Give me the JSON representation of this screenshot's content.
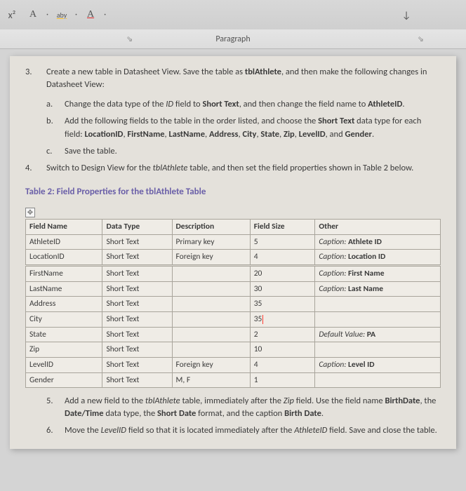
{
  "ribbon": {
    "superscript": "x²",
    "font_a1": "A",
    "highlighter": "aby",
    "font_a2": "A",
    "paragraph_label": "Paragraph",
    "launcher": "⇘"
  },
  "step3": {
    "num": "3.",
    "text_before_bold": "Create a new table in Datasheet View. Save the table as ",
    "bold1": "tblAthlete",
    "text_after_bold": ", and then make the following changes in Datasheet View:",
    "a": {
      "let": "a.",
      "p1": "Change the data type of the ",
      "i1": "ID",
      "p2": " field to ",
      "b1": "Short Text",
      "p3": ", and then change the field name to ",
      "b2": "AthleteID",
      "p4": "."
    },
    "b": {
      "let": "b.",
      "p1": "Add the following fields to the table in the order listed, and choose the ",
      "b1": "Short Text",
      "p2": " data type for each field: ",
      "b2": "LocationID",
      "c1": ", ",
      "b3": "FirstName",
      "c2": ", ",
      "b4": "LastName",
      "c3": ", ",
      "b5": "Address",
      "c4": ", ",
      "b6": "City",
      "c5": ", ",
      "b7": "State",
      "c6": ", ",
      "b8": "Zip",
      "c7": ", ",
      "b9": "LevelID",
      "c8": ", and ",
      "b10": "Gender",
      "p3": "."
    },
    "c": {
      "let": "c.",
      "p1": "Save the table."
    }
  },
  "step4": {
    "num": "4.",
    "p1": "Switch to Design View for the ",
    "i1": "tblAthlete",
    "p2": " table, and then set the field properties shown in Table 2 below."
  },
  "table_title": "Table 2: Field Properties for the tblAthlete Table",
  "headers": {
    "c1": "Field Name",
    "c2": "Data Type",
    "c3": "Description",
    "c4": "Field Size",
    "c5": "Other"
  },
  "rows": [
    {
      "c1": "AthleteID",
      "c2": "Short Text",
      "c3": "Primary key",
      "c4": "5",
      "c5p": "Caption:",
      "c5v": " Athlete ID"
    },
    {
      "c1": "LocationID",
      "c2": "Short Text",
      "c3": "Foreign key",
      "c4": "4",
      "c5p": "Caption:",
      "c5v": " Location ID"
    },
    {
      "c1": "FirstName",
      "c2": "Short Text",
      "c3": "",
      "c4": "20",
      "c5p": "Caption:",
      "c5v": " First Name"
    },
    {
      "c1": "LastName",
      "c2": "Short Text",
      "c3": "",
      "c4": "30",
      "c5p": "Caption:",
      "c5v": " Last Name"
    },
    {
      "c1": "Address",
      "c2": "Short Text",
      "c3": "",
      "c4": "35",
      "c5p": "",
      "c5v": ""
    },
    {
      "c1": "City",
      "c2": "Short Text",
      "c3": "",
      "c4": "35",
      "c5p": "",
      "c5v": ""
    },
    {
      "c1": "State",
      "c2": "Short Text",
      "c3": "",
      "c4": "2",
      "c5p": "Default Value:",
      "c5v": " PA"
    },
    {
      "c1": "Zip",
      "c2": "Short Text",
      "c3": "",
      "c4": "10",
      "c5p": "",
      "c5v": ""
    },
    {
      "c1": "LevelID",
      "c2": "Short Text",
      "c3": "Foreign key",
      "c4": "4",
      "c5p": "Caption:",
      "c5v": " Level ID"
    },
    {
      "c1": "Gender",
      "c2": "Short Text",
      "c3": "M, F",
      "c4": "1",
      "c5p": "",
      "c5v": ""
    }
  ],
  "step5": {
    "num": "5.",
    "p1": "Add a new field to the ",
    "i1": "tblAthlete",
    "p2": " table, immediately after the ",
    "i2": "Zip",
    "p3": " field. Use the field name ",
    "b1": "BirthDate",
    "p4": ", the ",
    "b2": "Date/Time",
    "p5": " data type, the ",
    "b3": "Short Date",
    "p6": " format, and the caption ",
    "b4": "Birth Date",
    "p7": "."
  },
  "step6": {
    "num": "6.",
    "p1": "Move the ",
    "i1": "LevelID",
    "p2": " field so that it is located immediately after the ",
    "i2": "AthleteID",
    "p3": " field. Save and close the table."
  }
}
